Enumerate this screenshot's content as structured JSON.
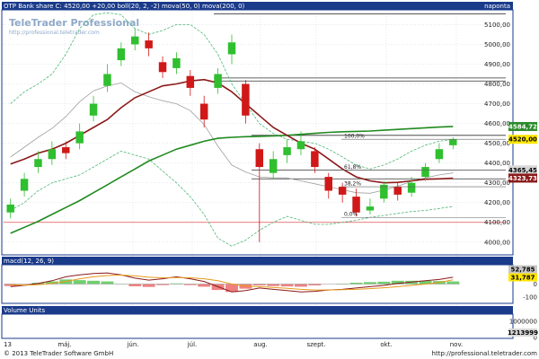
{
  "header": {
    "title": "OTP Bank share C: 4520,00 +20,00 boll(20, 2, -2) mova(50, 0) mova(200, 0)",
    "period": "naponta"
  },
  "watermark": {
    "name": "TeleTrader Professional",
    "url": "http://professional.teletrader.com"
  },
  "fib_labels": [
    "100,0%",
    "61,8%",
    "38,2%",
    "0,0%"
  ],
  "price_tags": [
    {
      "text": "4584,72",
      "bg": "#2a8a2a",
      "fg": "#ffffff"
    },
    {
      "text": "4520,00",
      "bg": "#ffe600",
      "fg": "#000000"
    },
    {
      "text": "4365,45",
      "bg": "#d8d8d8",
      "fg": "#000000"
    },
    {
      "text": "4323,73",
      "bg": "#8b1a1a",
      "fg": "#ffffff"
    }
  ],
  "macd_panel": {
    "title": "macd(12, 26, 9)",
    "value_tags": [
      {
        "text": "52,785",
        "bg": "#c8c8c8",
        "fg": "#000000"
      },
      {
        "text": "31,787",
        "bg": "#ffe600",
        "fg": "#000000"
      }
    ]
  },
  "volume_panel": {
    "title": "Volume Units",
    "value_tag": {
      "text": "1213999",
      "bg": "#d8d8d8",
      "fg": "#000000"
    }
  },
  "footer": {
    "copyright": "© 2013 TeleTrader Software GmbH",
    "url": "http://professional.teletrader.com"
  },
  "colors": {
    "header_bg": "#1a3a8a",
    "up_candle": "#2fbf2f",
    "down_candle": "#d01818",
    "boll": "#50b878",
    "mova50": "#8b1a1a",
    "mova200": "#1f8a1f",
    "macd_line": "#8b1a1a",
    "signal_line": "#e69a1a"
  },
  "chart_data": [
    {
      "type": "candlestick",
      "title": "OTP Bank share C: 4520,00 +20,00 boll(20, 2, -2) mova(50, 0) mova(200, 0)",
      "x_tick_labels": [
        "13",
        "máj.",
        "jún.",
        "júl.",
        "aug.",
        "szept.",
        "okt.",
        "nov."
      ],
      "y_tick_labels": [
        "4000,00",
        "4100,00",
        "4200,00",
        "4300,00",
        "4400,00",
        "4500,00",
        "4600,00",
        "4700,00",
        "4800,00",
        "4900,00",
        "5000,00",
        "5100,00"
      ],
      "ylim": [
        3940,
        5170
      ],
      "grid": true,
      "series": [
        {
          "name": "mova(50, 0)",
          "values": [
            4395,
            4420,
            4450,
            4470,
            4500,
            4540,
            4580,
            4620,
            4680,
            4730,
            4760,
            4790,
            4800,
            4815,
            4822,
            4805,
            4760,
            4700,
            4640,
            4580,
            4540,
            4500,
            4470,
            4420,
            4370,
            4330,
            4310,
            4300,
            4302,
            4310,
            4318,
            4320,
            4323
          ]
        },
        {
          "name": "mova(200, 0)",
          "values": [
            4045,
            4075,
            4105,
            4140,
            4175,
            4210,
            4250,
            4290,
            4330,
            4370,
            4410,
            4440,
            4470,
            4490,
            4510,
            4525,
            4530,
            4533,
            4535,
            4537,
            4540,
            4545,
            4550,
            4555,
            4558,
            4560,
            4562,
            4566,
            4570,
            4574,
            4578,
            4582,
            4585
          ]
        }
      ],
      "bollinger_upper": [
        4700,
        4760,
        4800,
        4850,
        4950,
        5080,
        5150,
        5160,
        5150,
        5080,
        5050,
        5070,
        5100,
        5100,
        5050,
        4950,
        4800,
        4700,
        4600,
        4550,
        4520,
        4510,
        4500,
        4470,
        4430,
        4390,
        4370,
        4390,
        4420,
        4460,
        4490,
        4510,
        4520
      ],
      "bollinger_lower": [
        4160,
        4200,
        4260,
        4300,
        4320,
        4340,
        4380,
        4420,
        4460,
        4440,
        4420,
        4360,
        4300,
        4230,
        4140,
        4020,
        3980,
        4010,
        4060,
        4100,
        4130,
        4110,
        4090,
        4090,
        4100,
        4110,
        4125,
        4135,
        4145,
        4155,
        4160,
        4170,
        4180
      ],
      "close": [
        4190,
        4320,
        4420,
        4470,
        4450,
        4560,
        4700,
        4850,
        4980,
        5040,
        4980,
        4860,
        4930,
        4780,
        4620,
        4850,
        5010,
        4640,
        4380,
        4420,
        4480,
        4510,
        4380,
        4260,
        4240,
        4150,
        4180,
        4290,
        4240,
        4300,
        4380,
        4470,
        4520
      ],
      "open": [
        4150,
        4260,
        4380,
        4420,
        4480,
        4500,
        4640,
        4790,
        4920,
        5000,
        5020,
        4910,
        4880,
        4840,
        4700,
        4780,
        4950,
        4800,
        4470,
        4350,
        4440,
        4470,
        4460,
        4330,
        4280,
        4230,
        4160,
        4220,
        4280,
        4250,
        4330,
        4420,
        4490
      ],
      "high": [
        4220,
        4350,
        4460,
        4510,
        4510,
        4600,
        4740,
        4900,
        5010,
        5080,
        5060,
        4940,
        4960,
        4870,
        4740,
        4880,
        5050,
        4820,
        4500,
        4460,
        4520,
        4560,
        4480,
        4350,
        4300,
        4270,
        4220,
        4310,
        4300,
        4330,
        4400,
        4500,
        4530
      ],
      "low": [
        4120,
        4230,
        4350,
        4390,
        4420,
        4470,
        4610,
        4760,
        4890,
        4970,
        4940,
        4830,
        4850,
        4740,
        4580,
        4750,
        4900,
        4600,
        4000,
        4320,
        4400,
        4440,
        4350,
        4220,
        4200,
        4130,
        4140,
        4200,
        4210,
        4230,
        4310,
        4400,
        4470
      ],
      "fibonacci": [
        {
          "label": "100,0%",
          "value": 4520
        },
        {
          "label": "61,8%",
          "value": 4365
        },
        {
          "label": "38,2%",
          "value": 4280
        },
        {
          "label": "0,0%",
          "value": 4125
        }
      ],
      "horizontal_lines": [
        5155,
        4830,
        4815,
        4540,
        4365,
        4320,
        4100
      ],
      "last_values": {
        "close": 4520.0,
        "change": 20.0,
        "mova200": 4584.72,
        "mova50": 4323.73,
        "boll_mid": 4365.45
      }
    },
    {
      "type": "line",
      "title": "macd(12, 26, 9)",
      "y_tick_labels": [
        "100",
        "0",
        "-100"
      ],
      "ylim": [
        -140,
        140
      ],
      "grid": true,
      "series": [
        {
          "name": "macd",
          "values": [
            -20,
            -10,
            5,
            25,
            55,
            70,
            80,
            85,
            70,
            45,
            30,
            40,
            55,
            40,
            20,
            -20,
            -60,
            -50,
            -30,
            -40,
            -50,
            -60,
            -55,
            -45,
            -40,
            -30,
            -20,
            -10,
            5,
            15,
            25,
            35,
            52
          ]
        },
        {
          "name": "signal",
          "values": [
            -5,
            -8,
            -5,
            5,
            20,
            40,
            55,
            65,
            68,
            62,
            52,
            48,
            50,
            48,
            40,
            25,
            0,
            -15,
            -20,
            -25,
            -32,
            -40,
            -45,
            -45,
            -43,
            -40,
            -35,
            -28,
            -20,
            -10,
            0,
            12,
            32
          ]
        },
        {
          "name": "histogram",
          "values": [
            -15,
            -2,
            10,
            20,
            35,
            30,
            25,
            20,
            2,
            -17,
            -22,
            -8,
            5,
            -8,
            -20,
            -45,
            -60,
            -35,
            -10,
            -15,
            -18,
            -20,
            -10,
            0,
            3,
            10,
            15,
            18,
            25,
            25,
            25,
            23,
            20
          ]
        }
      ],
      "last_values": [
        "52,785",
        "31,787"
      ]
    },
    {
      "type": "bar",
      "title": "Volume Units",
      "y_tick_labels": [
        "1000000",
        "0"
      ],
      "ylim": [
        0,
        1400000
      ],
      "grid": true,
      "series": [
        {
          "name": "volume",
          "values": []
        }
      ],
      "last_values": [
        "1213999"
      ]
    }
  ]
}
